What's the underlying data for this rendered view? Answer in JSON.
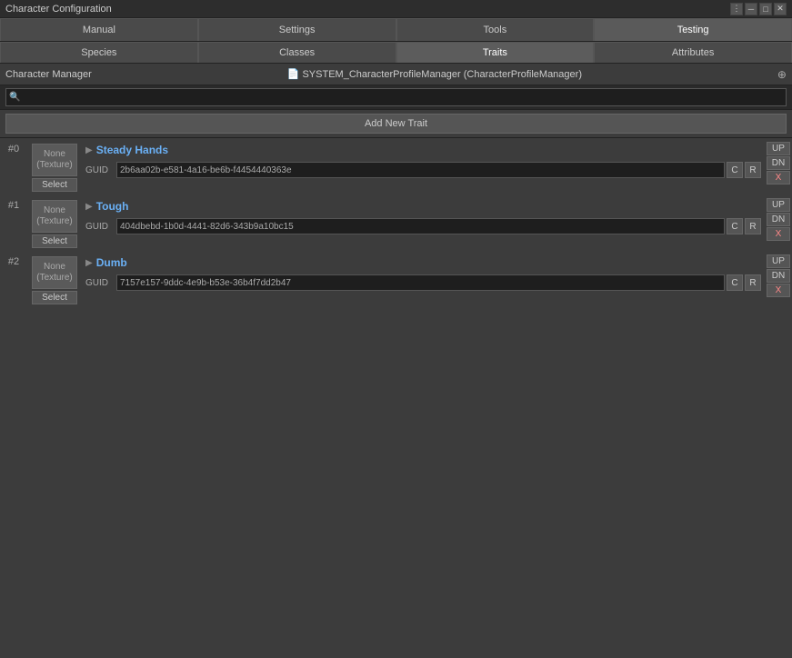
{
  "titleBar": {
    "title": "Character Configuration",
    "controls": [
      "menu",
      "minimize",
      "maximize",
      "close"
    ]
  },
  "tabs": [
    {
      "id": "manual",
      "label": "Manual",
      "active": false
    },
    {
      "id": "settings",
      "label": "Settings",
      "active": false
    },
    {
      "id": "tools",
      "label": "Tools",
      "active": false
    },
    {
      "id": "testing",
      "label": "Testing",
      "active": true
    }
  ],
  "subtabs": [
    {
      "id": "species",
      "label": "Species",
      "active": false
    },
    {
      "id": "classes",
      "label": "Classes",
      "active": false
    },
    {
      "id": "traits",
      "label": "Traits",
      "active": true
    },
    {
      "id": "attributes",
      "label": "Attributes",
      "active": false
    }
  ],
  "manager": {
    "title": "Character Manager",
    "link": "📄 SYSTEM_CharacterProfileManager (CharacterProfileManager)"
  },
  "search": {
    "placeholder": "",
    "icon": "🔍"
  },
  "addButton": "Add New Trait",
  "traits": [
    {
      "index": "#0",
      "texture": {
        "line1": "None",
        "line2": "(Texture)"
      },
      "selectLabel": "Select",
      "name": "Steady Hands",
      "guid": "2b6aa02b-e581-4a16-be6b-f4454440363e",
      "guidLabel": "GUID",
      "actions": {
        "up": "UP",
        "dn": "DN",
        "x": "X"
      }
    },
    {
      "index": "#1",
      "texture": {
        "line1": "None",
        "line2": "(Texture)"
      },
      "selectLabel": "Select",
      "name": "Tough",
      "guid": "404dbebd-1b0d-4441-82d6-343b9a10bc15",
      "guidLabel": "GUID",
      "actions": {
        "up": "UP",
        "dn": "DN",
        "x": "X"
      }
    },
    {
      "index": "#2",
      "texture": {
        "line1": "None",
        "line2": "(Texture)"
      },
      "selectLabel": "Select",
      "name": "Dumb",
      "guid": "7157e157-9ddc-4e9b-b53e-36b4f7dd2b47",
      "guidLabel": "GUID",
      "actions": {
        "up": "UP",
        "dn": "DN",
        "x": "X"
      }
    }
  ],
  "icons": {
    "expand": "▶",
    "copy": "C",
    "refresh": "R",
    "search": "🔍",
    "menu": "⋮",
    "minimize": "─",
    "maximize": "□",
    "close": "✕",
    "circle": "⊕"
  }
}
